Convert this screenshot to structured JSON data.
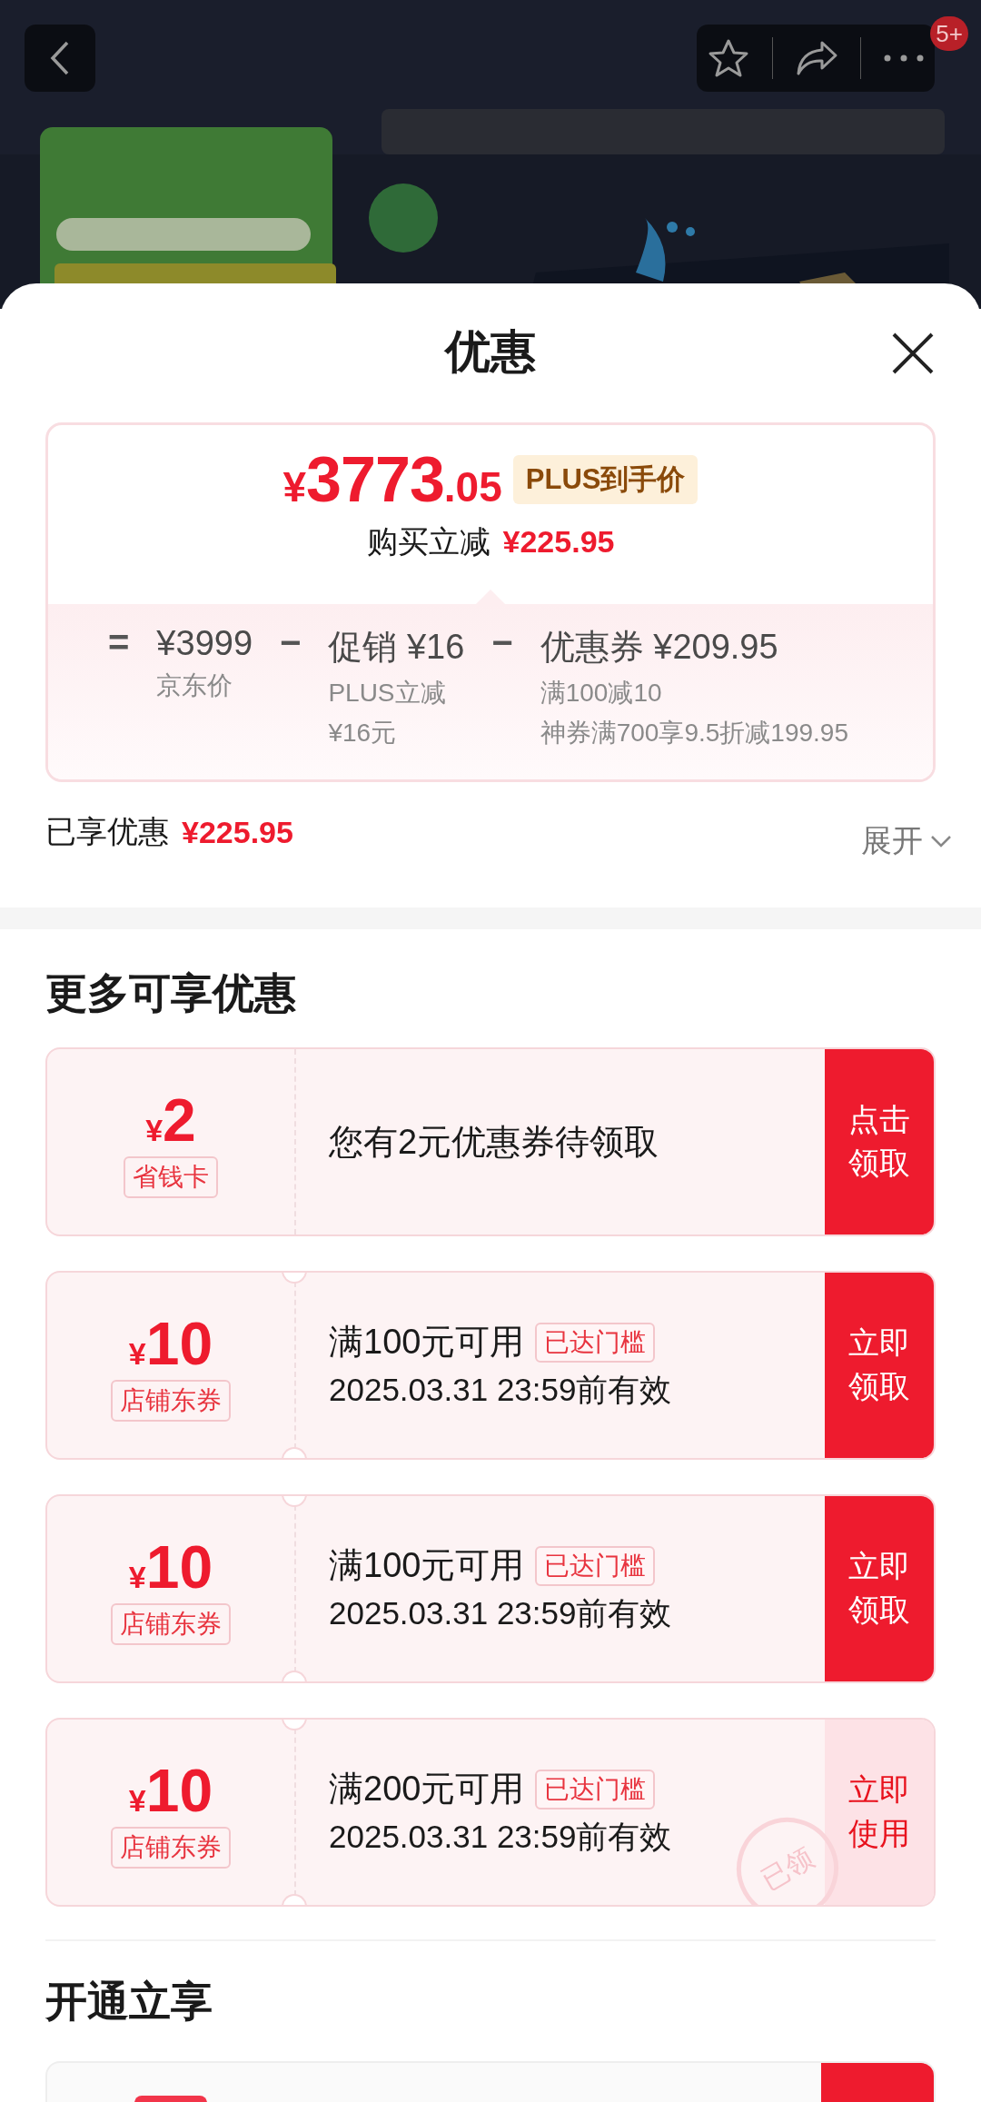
{
  "header": {
    "badge": "5+"
  },
  "sheet": {
    "title": "优惠"
  },
  "price_card": {
    "price": {
      "symbol": "¥",
      "integer": "3773",
      "decimal": ".05"
    },
    "tag": "PLUS到手价",
    "reduction_label": "购买立减",
    "reduction_amount": "¥225.95",
    "breakdown": [
      {
        "kind": "operator",
        "text": "="
      },
      {
        "kind": "term",
        "amount": "¥3999",
        "notes": [
          "京东价"
        ]
      },
      {
        "kind": "operator",
        "text": "−"
      },
      {
        "kind": "term",
        "label": "促销",
        "amount": "¥16",
        "notes": [
          "PLUS立减",
          "¥16元"
        ]
      },
      {
        "kind": "operator",
        "text": "−"
      },
      {
        "kind": "term",
        "label": "优惠券",
        "amount": "¥209.95",
        "notes": [
          "满100减10",
          "神券满700享9.5折减199.95"
        ]
      }
    ]
  },
  "enjoyed": {
    "label": "已享优惠",
    "amount": "¥225.95",
    "expand": "展开"
  },
  "more_section": {
    "title": "更多可享优惠",
    "coupons": [
      {
        "kind": "notice",
        "symbol": "¥",
        "amount": "2",
        "tag": "省钱卡",
        "text": "您有2元优惠券待领取",
        "button": "点击领取",
        "claimed": false
      },
      {
        "kind": "threshold",
        "symbol": "¥",
        "amount": "10",
        "tag": "店铺东券",
        "condition": "满100元可用",
        "badge": "已达门槛",
        "validity": "2025.03.31 23:59前有效",
        "button": "立即领取",
        "claimed": false
      },
      {
        "kind": "threshold",
        "symbol": "¥",
        "amount": "10",
        "tag": "店铺东券",
        "condition": "满100元可用",
        "badge": "已达门槛",
        "validity": "2025.03.31 23:59前有效",
        "button": "立即领取",
        "claimed": false
      },
      {
        "kind": "threshold",
        "symbol": "¥",
        "amount": "10",
        "tag": "店铺东券",
        "condition": "满200元可用",
        "badge": "已达门槛",
        "validity": "2025.03.31 23:59前有效",
        "button": "立即使用",
        "claimed": true,
        "stamp": "已领"
      }
    ]
  },
  "open_section": {
    "title": "开通立享"
  }
}
